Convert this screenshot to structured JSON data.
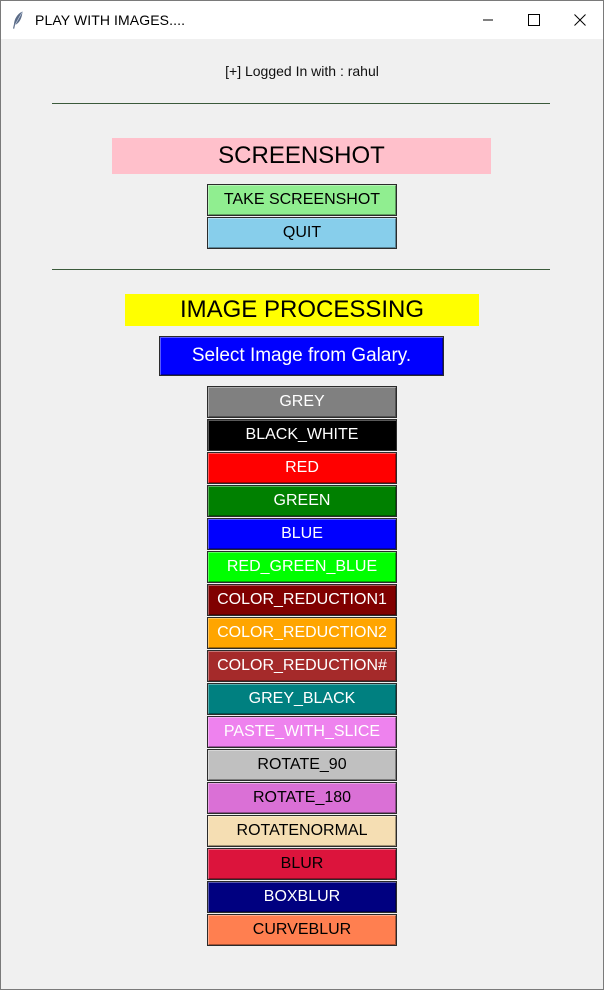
{
  "window": {
    "title": "PLAY WITH IMAGES....",
    "icon": "feather-icon",
    "controls": [
      "minimize-icon",
      "maximize-icon",
      "close-icon"
    ]
  },
  "login": {
    "text": "[+] Logged In with : rahul"
  },
  "screenshot_section": {
    "heading": "SCREENSHOT",
    "heading_bg": "#ffc0cb",
    "take_label": "TAKE SCREENSHOT",
    "take_bg": "#90ee90",
    "quit_label": "QUIT",
    "quit_bg": "#87ceeb"
  },
  "image_section": {
    "heading": "IMAGE PROCESSING",
    "heading_bg": "#ffff00",
    "gallery_label": "Select Image from Galary.",
    "gallery_bg": "#0000ff"
  },
  "filters": [
    {
      "label": "GREY",
      "bg": "#808080",
      "fg": "#ffffff"
    },
    {
      "label": "BLACK_WHITE",
      "bg": "#000000",
      "fg": "#ffffff"
    },
    {
      "label": "RED",
      "bg": "#ff0000",
      "fg": "#ffffff"
    },
    {
      "label": "GREEN",
      "bg": "#008000",
      "fg": "#ffffff"
    },
    {
      "label": "BLUE",
      "bg": "#0000ff",
      "fg": "#ffffff"
    },
    {
      "label": "RED_GREEN_BLUE",
      "bg": "#00ff00",
      "fg": "#ffffff"
    },
    {
      "label": "COLOR_REDUCTION1",
      "bg": "#800000",
      "fg": "#ffffff"
    },
    {
      "label": "COLOR_REDUCTION2",
      "bg": "#ffa500",
      "fg": "#ffffff"
    },
    {
      "label": "COLOR_REDUCTION#",
      "bg": "#a52a2a",
      "fg": "#ffffff"
    },
    {
      "label": "GREY_BLACK",
      "bg": "#008080",
      "fg": "#ffffff"
    },
    {
      "label": "PASTE_WITH_SLICE",
      "bg": "#ee82ee",
      "fg": "#ffffff"
    },
    {
      "label": "ROTATE_90",
      "bg": "#c0c0c0",
      "fg": "#000000"
    },
    {
      "label": "ROTATE_180",
      "bg": "#da70d6",
      "fg": "#000000"
    },
    {
      "label": "ROTATENORMAL",
      "bg": "#f5deb3",
      "fg": "#000000"
    },
    {
      "label": "BLUR",
      "bg": "#dc143c",
      "fg": "#000000"
    },
    {
      "label": "BOXBLUR",
      "bg": "#000080",
      "fg": "#ffffff"
    },
    {
      "label": "CURVEBLUR",
      "bg": "#ff7f50",
      "fg": "#000000"
    }
  ]
}
